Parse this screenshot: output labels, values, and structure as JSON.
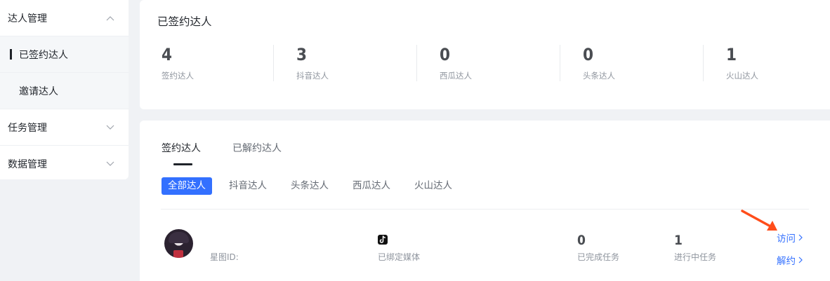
{
  "sidebar": {
    "groups": [
      {
        "label": "达人管理"
      },
      {
        "label": "任务管理"
      },
      {
        "label": "数据管理"
      }
    ],
    "sub_items": [
      {
        "label": "已签约达人"
      },
      {
        "label": "邀请达人"
      }
    ]
  },
  "summary": {
    "title": "已签约达人",
    "stats": [
      {
        "value": "4",
        "label": "签约达人"
      },
      {
        "value": "3",
        "label": "抖音达人"
      },
      {
        "value": "0",
        "label": "西瓜达人"
      },
      {
        "value": "0",
        "label": "头条达人"
      },
      {
        "value": "1",
        "label": "火山达人"
      }
    ]
  },
  "list": {
    "tabs": [
      {
        "label": "签约达人"
      },
      {
        "label": "已解约达人"
      }
    ],
    "filters": [
      {
        "label": "全部达人"
      },
      {
        "label": "抖音达人"
      },
      {
        "label": "头条达人"
      },
      {
        "label": "西瓜达人"
      },
      {
        "label": "火山达人"
      }
    ],
    "rows": [
      {
        "star_id_label": "星图ID:",
        "media_label": "已绑定媒体",
        "completed_value": "0",
        "completed_label": "已完成任务",
        "in_progress_value": "1",
        "in_progress_label": "进行中任务",
        "visit_label": "访问",
        "terminate_label": "解约"
      }
    ]
  },
  "colors": {
    "accent": "#3370ff",
    "annotation_arrow": "#ff4d1a"
  },
  "icons": [
    "chevron-up-icon",
    "chevron-down-icon",
    "tiktok-icon",
    "chevron-right-icon",
    "annotation-arrow"
  ]
}
